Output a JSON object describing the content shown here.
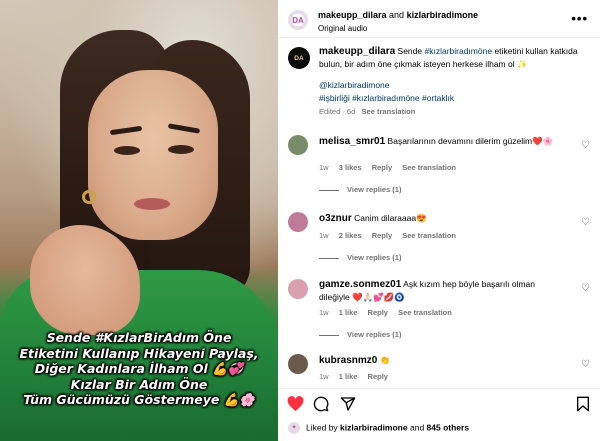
{
  "media": {
    "overlay_lines": [
      "Sende #KızlarBirAdım Öne",
      "Etiketini Kullanıp Hikayeni Paylaş,",
      "Diğer Kadınlara İlham Ol 💪💞",
      "Kızlar Bir Adım Öne",
      "Tüm Gücümüzü Göstermeye 💪🌸"
    ]
  },
  "header": {
    "author": "makeupp_dilara",
    "and": "and",
    "coauthor": "kizlarbiradimone",
    "audio": "Original audio",
    "avatar_text": "DA",
    "more_icon": "more-horizontal-icon"
  },
  "caption": {
    "avatar_text": "DA",
    "user": "makeupp_dilara",
    "text_before": "Sende",
    "hashtag1": "#kızlarbiradımöne",
    "text_after": "etiketini kullan katkıda bulun, bir adım öne çıkmak isteyen herkese ilham ol ✨",
    "mention": "@kizlarbiradimone",
    "hashtags": "#işbirliği #kızlarbiradımöne #ortaklık",
    "edited": "Edited · 6d",
    "see_translation": "See translation"
  },
  "comments": [
    {
      "user": "melisa_smr01",
      "text": "Başarılarının devamını dilerim güzelim❤️🌸",
      "time": "1w",
      "likes": "3 likes",
      "reply": "Reply",
      "see_translation": "See translation",
      "view_replies": "View replies (1)",
      "avatar_color": "#7a8b6a"
    },
    {
      "user": "o3znur",
      "text": "Canim dilaraaaa😍",
      "time": "1w",
      "likes": "2 likes",
      "reply": "Reply",
      "see_translation": "See translation",
      "view_replies": "View replies (1)",
      "avatar_color": "#c07a9a"
    },
    {
      "user": "gamze.sonmez01",
      "text": "Aşk kızım hep böyle başarılı olman dileğiyle ❤️🙏🏻💕💋🧿",
      "time": "1w",
      "likes": "1 like",
      "reply": "Reply",
      "see_translation": "See translation",
      "view_replies": "View replies (1)",
      "avatar_color": "#d9a0b0"
    },
    {
      "user": "kubrasnmz0",
      "text": "👏",
      "time": "1w",
      "likes": "1 like",
      "reply": "Reply",
      "avatar_color": "#6b5a4e"
    }
  ],
  "actions": {
    "like_icon": "heart-filled-icon",
    "comment_icon": "comment-icon",
    "share_icon": "send-icon",
    "save_icon": "bookmark-icon",
    "liked_by_prefix": "Liked by",
    "liked_by_user": "kizlarbiradimone",
    "and": "and",
    "others": "845 others",
    "colors": {
      "like": "#ff3040",
      "link": "#00376b",
      "muted": "#737373"
    }
  }
}
